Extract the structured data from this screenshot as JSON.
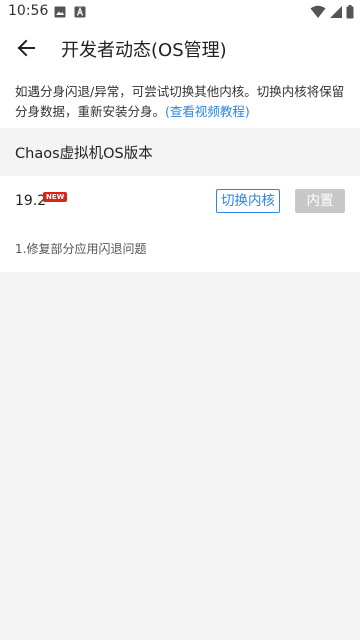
{
  "status_bar": {
    "time": "10:56",
    "left_icons": [
      "image-icon",
      "a-icon"
    ],
    "right_icons": [
      "wifi-icon",
      "signal-icon",
      "battery-icon"
    ]
  },
  "app_bar": {
    "back_icon": "arrow-left-icon",
    "title": "开发者动态(OS管理)"
  },
  "notice": {
    "text": "如遇分身闪退/异常，可尝试切换其他内核。切换内核将保留分身数据，重新安装分身。",
    "link": "(查看视频教程)"
  },
  "section": {
    "title": "Chaos虚拟机OS版本"
  },
  "version_item": {
    "version": "19.2",
    "badge": "NEW",
    "switch_label": "切换内核",
    "builtin_label": "内置",
    "changelog": "1.修复部分应用闪退问题"
  },
  "colors": {
    "accent": "#2a87e8",
    "badge": "#d9241c",
    "disabled": "#c8c8c8",
    "background": "#f4f4f4"
  }
}
